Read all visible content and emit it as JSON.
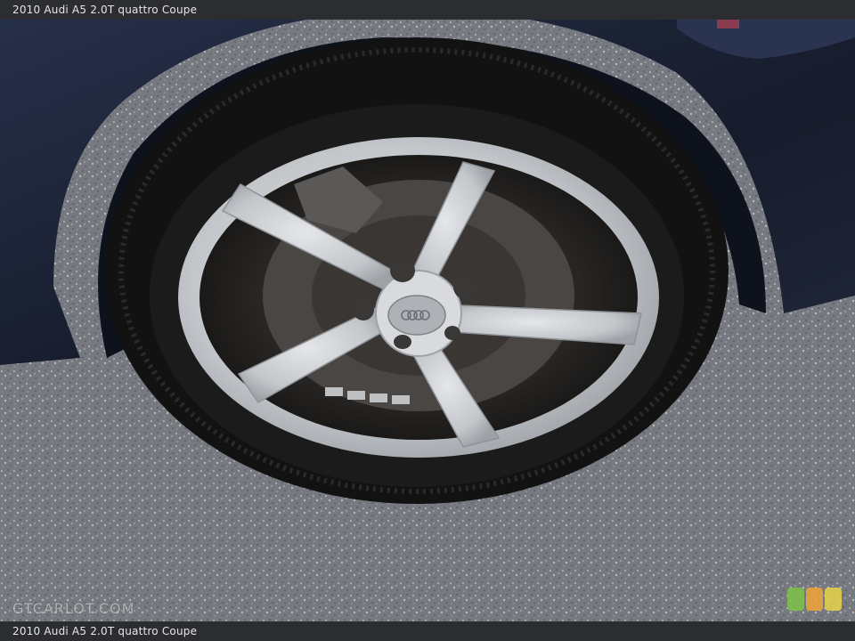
{
  "header": {
    "caption": "2010 Audi A5 2.0T quattro Coupe"
  },
  "footer": {
    "caption": "2010 Audi A5 2.0T quattro Coupe"
  },
  "watermark": {
    "text": "GTCARLOT.COM"
  },
  "photo": {
    "subject": "alloy-wheel-with-tire",
    "colors": {
      "car_body": "#1c2436",
      "tire": "#141414",
      "rim": "#c9cbce",
      "pavement": "#777a80",
      "title_bar": "#2b2d31"
    }
  },
  "badge": {
    "colors": [
      "#7ec24a",
      "#f0a43a",
      "#e9d24a"
    ]
  }
}
